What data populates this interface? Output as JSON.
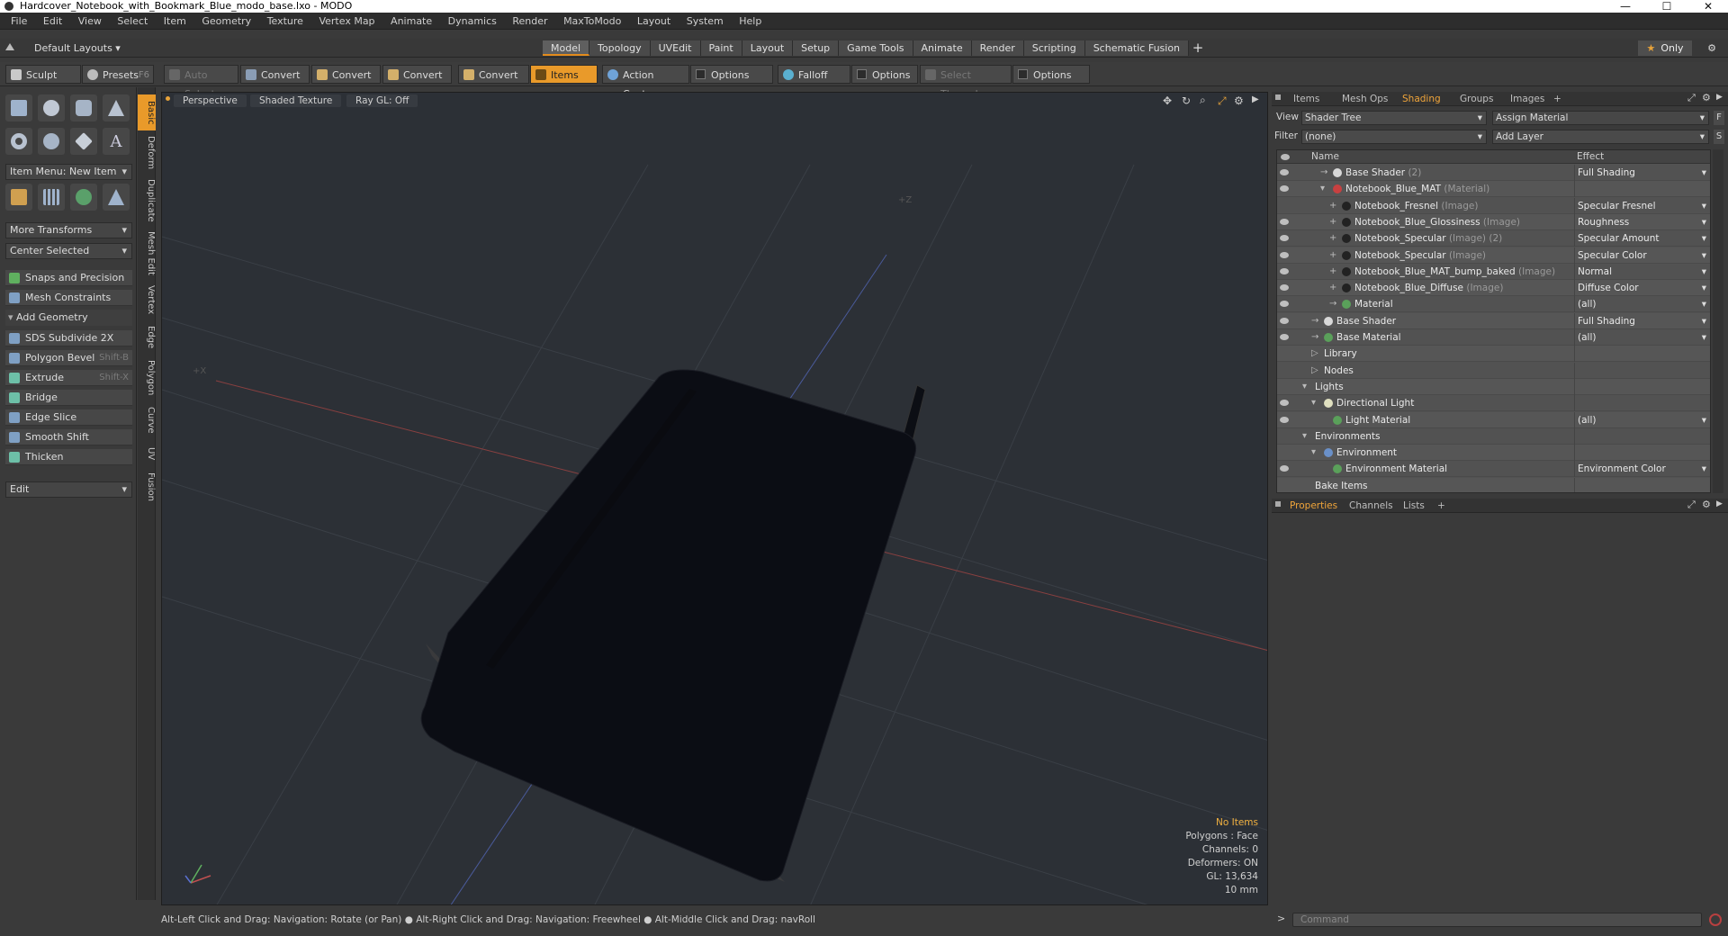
{
  "window": {
    "title": "Hardcover_Notebook_with_Bookmark_Blue_modo_base.lxo - MODO",
    "min": "—",
    "max": "☐",
    "close": "✕"
  },
  "menu": [
    "File",
    "Edit",
    "View",
    "Select",
    "Item",
    "Geometry",
    "Texture",
    "Vertex Map",
    "Animate",
    "Dynamics",
    "Render",
    "MaxToModo",
    "Layout",
    "System",
    "Help"
  ],
  "layout": {
    "default_layouts": "Default Layouts ▾",
    "tabs": [
      "Model",
      "Topology",
      "UVEdit",
      "Paint",
      "Layout",
      "Setup",
      "Game Tools",
      "Animate",
      "Render",
      "Scripting",
      "Schematic Fusion"
    ],
    "active_tab": "Model",
    "plus": "+",
    "only": "Only",
    "star": "★"
  },
  "toolbar": {
    "sculpt": "Sculpt",
    "presets": "Presets",
    "presets_shortcut": "F6",
    "auto_select": "Auto Select",
    "convert1": "Convert",
    "convert2": "Convert",
    "convert3": "Convert",
    "convert4": "Convert",
    "items": "Items",
    "action_center": "Action Center",
    "options1": "Options",
    "falloff": "Falloff",
    "options2": "Options",
    "select_through": "Select Through",
    "options3": "Options"
  },
  "left": {
    "item_menu": "Item Menu: New Item",
    "more_transforms": "More Transforms",
    "center_selected": "Center Selected",
    "snaps": "Snaps and Precision",
    "mesh_constraints": "Mesh Constraints",
    "add_geometry": "Add Geometry",
    "tools": [
      {
        "label": "SDS Subdivide 2X",
        "shortcut": ""
      },
      {
        "label": "Polygon Bevel",
        "shortcut": "Shift-B"
      },
      {
        "label": "Extrude",
        "shortcut": "Shift-X"
      },
      {
        "label": "Bridge",
        "shortcut": ""
      },
      {
        "label": "Edge Slice",
        "shortcut": ""
      },
      {
        "label": "Smooth Shift",
        "shortcut": ""
      },
      {
        "label": "Thicken",
        "shortcut": ""
      }
    ],
    "edit": "Edit",
    "vtabs": [
      "Basic",
      "Deform",
      "Duplicate",
      "Mesh Edit",
      "Vertex",
      "Edge",
      "Polygon",
      "Curve",
      "UV",
      "Fusion"
    ]
  },
  "viewport": {
    "perspective": "Perspective",
    "shaded": "Shaded Texture",
    "raygl": "Ray GL: Off",
    "info": {
      "no_items": "No Items",
      "polygons": "Polygons : Face",
      "channels": "Channels: 0",
      "deformers": "Deformers: ON",
      "gl": "GL: 13,634",
      "scale": "10 mm"
    }
  },
  "status": "Alt-Left Click and Drag: Navigation: Rotate (or Pan) ● Alt-Right Click and Drag: Navigation: Freewheel ● Alt-Middle Click and Drag: navRoll",
  "right": {
    "tabs": [
      "Items",
      "Mesh Ops",
      "Shading",
      "Groups",
      "Images"
    ],
    "active": "Shading",
    "plus": "+",
    "view_label": "View",
    "view_value": "Shader Tree",
    "assign": "Assign Material",
    "filter_label": "Filter",
    "filter_value": "(none)",
    "add_layer": "Add Layer",
    "f_btn": "F",
    "s_btn": "S",
    "col_name": "Name",
    "col_effect": "Effect",
    "rows": [
      {
        "name": "Base Shader",
        "type": "(2)",
        "effect": "Full Shading",
        "indent": 2,
        "eye": true,
        "color": "#d8d8d8",
        "dd": true,
        "tw": "→"
      },
      {
        "name": "Notebook_Blue_MAT",
        "type": "(Material)",
        "effect": "",
        "indent": 2,
        "eye": true,
        "color": "#c84040",
        "dd": false,
        "tw": "▾"
      },
      {
        "name": "Notebook_Fresnel",
        "type": "(Image)",
        "effect": "Specular Fresnel",
        "indent": 3,
        "eye": false,
        "color": "#222",
        "dd": true,
        "tw": "+"
      },
      {
        "name": "Notebook_Blue_Glossiness",
        "type": "(Image)",
        "effect": "Roughness",
        "indent": 3,
        "eye": true,
        "color": "#222",
        "dd": true,
        "tw": "+"
      },
      {
        "name": "Notebook_Specular",
        "type": "(Image) (2)",
        "effect": "Specular Amount",
        "indent": 3,
        "eye": true,
        "color": "#222",
        "dd": true,
        "tw": "+"
      },
      {
        "name": "Notebook_Specular",
        "type": "(Image)",
        "effect": "Specular Color",
        "indent": 3,
        "eye": true,
        "color": "#222",
        "dd": true,
        "tw": "+"
      },
      {
        "name": "Notebook_Blue_MAT_bump_baked",
        "type": "(Image)",
        "effect": "Normal",
        "indent": 3,
        "eye": true,
        "color": "#222",
        "dd": true,
        "tw": "+"
      },
      {
        "name": "Notebook_Blue_Diffuse",
        "type": "(Image)",
        "effect": "Diffuse Color",
        "indent": 3,
        "eye": true,
        "color": "#222",
        "dd": true,
        "tw": "+"
      },
      {
        "name": "Material",
        "type": "",
        "effect": "(all)",
        "indent": 3,
        "eye": true,
        "color": "#5aa05a",
        "dd": true,
        "tw": "→"
      },
      {
        "name": "Base Shader",
        "type": "",
        "effect": "Full Shading",
        "indent": 1,
        "eye": true,
        "color": "#d8d8d8",
        "dd": true,
        "tw": "→"
      },
      {
        "name": "Base Material",
        "type": "",
        "effect": "(all)",
        "indent": 1,
        "eye": true,
        "color": "#5aa05a",
        "dd": true,
        "tw": "→"
      },
      {
        "name": "Library",
        "type": "",
        "effect": "",
        "indent": 1,
        "eye": false,
        "color": "",
        "dd": false,
        "tw": "▷"
      },
      {
        "name": "Nodes",
        "type": "",
        "effect": "",
        "indent": 1,
        "eye": false,
        "color": "",
        "dd": false,
        "tw": "▷"
      },
      {
        "name": "Lights",
        "type": "",
        "effect": "",
        "indent": 0,
        "eye": false,
        "color": "",
        "dd": false,
        "tw": "▾"
      },
      {
        "name": "Directional Light",
        "type": "",
        "effect": "",
        "indent": 1,
        "eye": true,
        "color": "#e0e0c0",
        "dd": false,
        "tw": "▾"
      },
      {
        "name": "Light Material",
        "type": "",
        "effect": "(all)",
        "indent": 2,
        "eye": true,
        "color": "#5aa05a",
        "dd": true,
        "tw": ""
      },
      {
        "name": "Environments",
        "type": "",
        "effect": "",
        "indent": 0,
        "eye": false,
        "color": "",
        "dd": false,
        "tw": "▾"
      },
      {
        "name": "Environment",
        "type": "",
        "effect": "",
        "indent": 1,
        "eye": false,
        "color": "#6a90c8",
        "dd": false,
        "tw": "▾"
      },
      {
        "name": "Environment Material",
        "type": "",
        "effect": "Environment Color",
        "indent": 2,
        "eye": true,
        "color": "#5aa05a",
        "dd": true,
        "tw": ""
      },
      {
        "name": "Bake Items",
        "type": "",
        "effect": "",
        "indent": 0,
        "eye": false,
        "color": "",
        "dd": false,
        "tw": ""
      }
    ],
    "prop_tabs": [
      "Properties",
      "Channels",
      "Lists"
    ],
    "prop_active": "Properties",
    "command_placeholder": "Command",
    "cmd_prompt": ">"
  }
}
